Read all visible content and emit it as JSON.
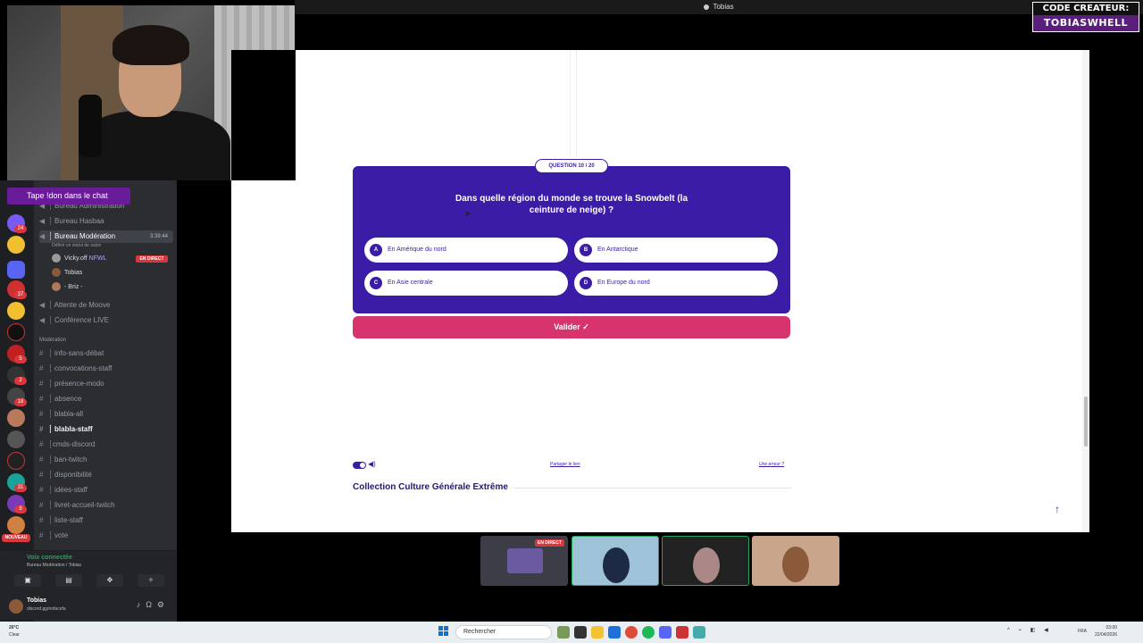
{
  "window": {
    "title": "Tobias"
  },
  "creator": {
    "line1": "CODE CREATEUR:",
    "line2": "TOBIASWHELL"
  },
  "chat_prompt": "Tape !don dans le chat",
  "discord": {
    "channels": [
      {
        "icon": "speaker",
        "label": "┊ Bureau Administration"
      },
      {
        "icon": "speaker",
        "label": "┊ Bureau Hasbaa"
      },
      {
        "icon": "speaker",
        "label": "┊ Bureau Modération",
        "timer": "3:39:44",
        "sub": "Définir un statut de salon"
      },
      {
        "icon": "speaker",
        "label": "┊ Attente de Moove"
      },
      {
        "icon": "speaker",
        "label": "┊ Conférence LIVE"
      }
    ],
    "voice_users": [
      {
        "name": "Vicky.off",
        "tag": "NFWL",
        "live": "EN DIRECT"
      },
      {
        "name": "Tobias"
      },
      {
        "name": "- Briz -"
      }
    ],
    "category": "Modération",
    "text_channels": [
      "┊ info-sans-débat",
      "┊ convocations-staff",
      "┊ présence-modo",
      "┊ absence",
      "┊ blabla-all",
      "┊ blabla-staff",
      "┊cmds-discord",
      "┊ ban-twitch",
      "┊ disponibilité",
      "┊ idées-staff",
      "┊ livret-accueil-twitch",
      "┊ liste-staff",
      "┊ vote"
    ],
    "voice_status": "Voix connectée",
    "voice_location": "Bureau Modération / Tobias",
    "user": {
      "name": "Tobias",
      "status": "discord.gg/nofacefa"
    },
    "nouveau": "NOUVEAU",
    "server_badges": [
      "24",
      "37",
      "5",
      "2",
      "18",
      "31",
      "8"
    ]
  },
  "quiz": {
    "badge": "QUESTION 10 / 20",
    "question": "Dans quelle région du monde se trouve la Snowbelt (la ceinture de neige) ?",
    "options": [
      {
        "letter": "A",
        "label": "En Amérique du nord"
      },
      {
        "letter": "B",
        "label": "En Antarctique"
      },
      {
        "letter": "C",
        "label": "En Asie centrale"
      },
      {
        "letter": "D",
        "label": "En Europe du nord"
      }
    ],
    "validate_label": "Valider ✓",
    "share_label": "Partager le lien",
    "error_label": "Une erreur ?",
    "collection_title": "Collection Culture Générale Extrême"
  },
  "tiles": {
    "live_badge": "EN DIRECT"
  },
  "taskbar": {
    "weather_temp": "26°C",
    "weather_desc": "Clear",
    "search_placeholder": "Rechercher",
    "lang": "FRA",
    "time": "03:00",
    "date": "22/04/2026"
  }
}
